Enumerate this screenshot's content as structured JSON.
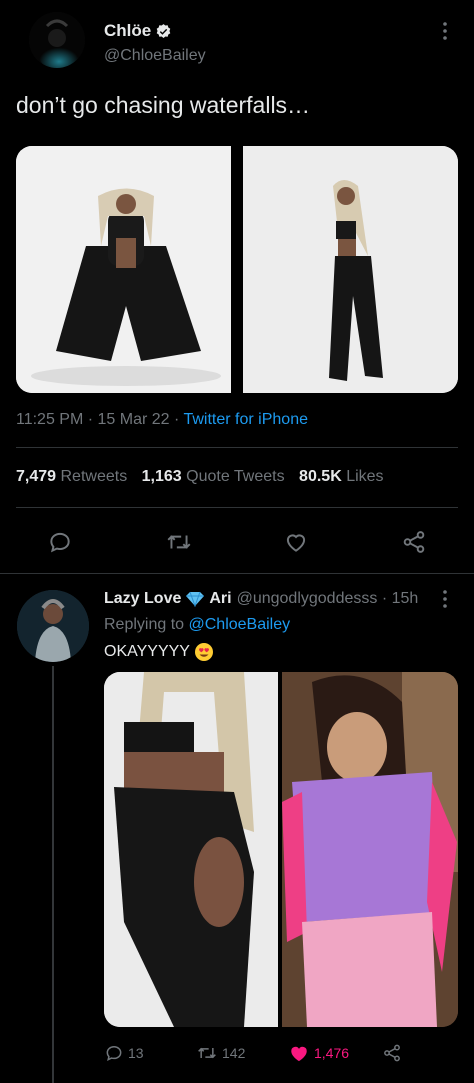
{
  "tweet": {
    "author": {
      "display_name": "Chlöe",
      "handle": "@ChloeBailey",
      "verified_icon": "verified-badge-icon"
    },
    "text": "don’t go chasing waterfalls…",
    "timestamp": "11:25 PM · 15 Mar 22 · ",
    "source": "Twitter for iPhone",
    "stats": {
      "retweets_count": "7,479",
      "retweets_label": "Retweets",
      "quotes_count": "1,163",
      "quotes_label": "Quote Tweets",
      "likes_count": "80.5K",
      "likes_label": "Likes"
    },
    "actions": [
      "reply-icon",
      "retweet-icon",
      "like-icon",
      "share-icon"
    ],
    "more_icon": "more-icon"
  },
  "reply": {
    "author": {
      "display_name_part1": "Lazy Love",
      "emoji_icon": "gem-icon",
      "display_name_part2": "Ari",
      "handle_time": "@ungodlygoddesss · 15h"
    },
    "replying_prefix": "Replying to ",
    "replying_to": "@ChloeBailey",
    "text": "OKAYYYYY",
    "text_emoji": "heart-eyes-emoji-icon",
    "stats": {
      "replies": "13",
      "retweets": "142",
      "likes": "1,476"
    },
    "more_icon": "more-icon"
  },
  "colors": {
    "background": "#000000",
    "text": "#e7e9ea",
    "muted": "#71767b",
    "link": "#1d9bf0",
    "like_active": "#f91880",
    "divider": "#2f3336"
  }
}
